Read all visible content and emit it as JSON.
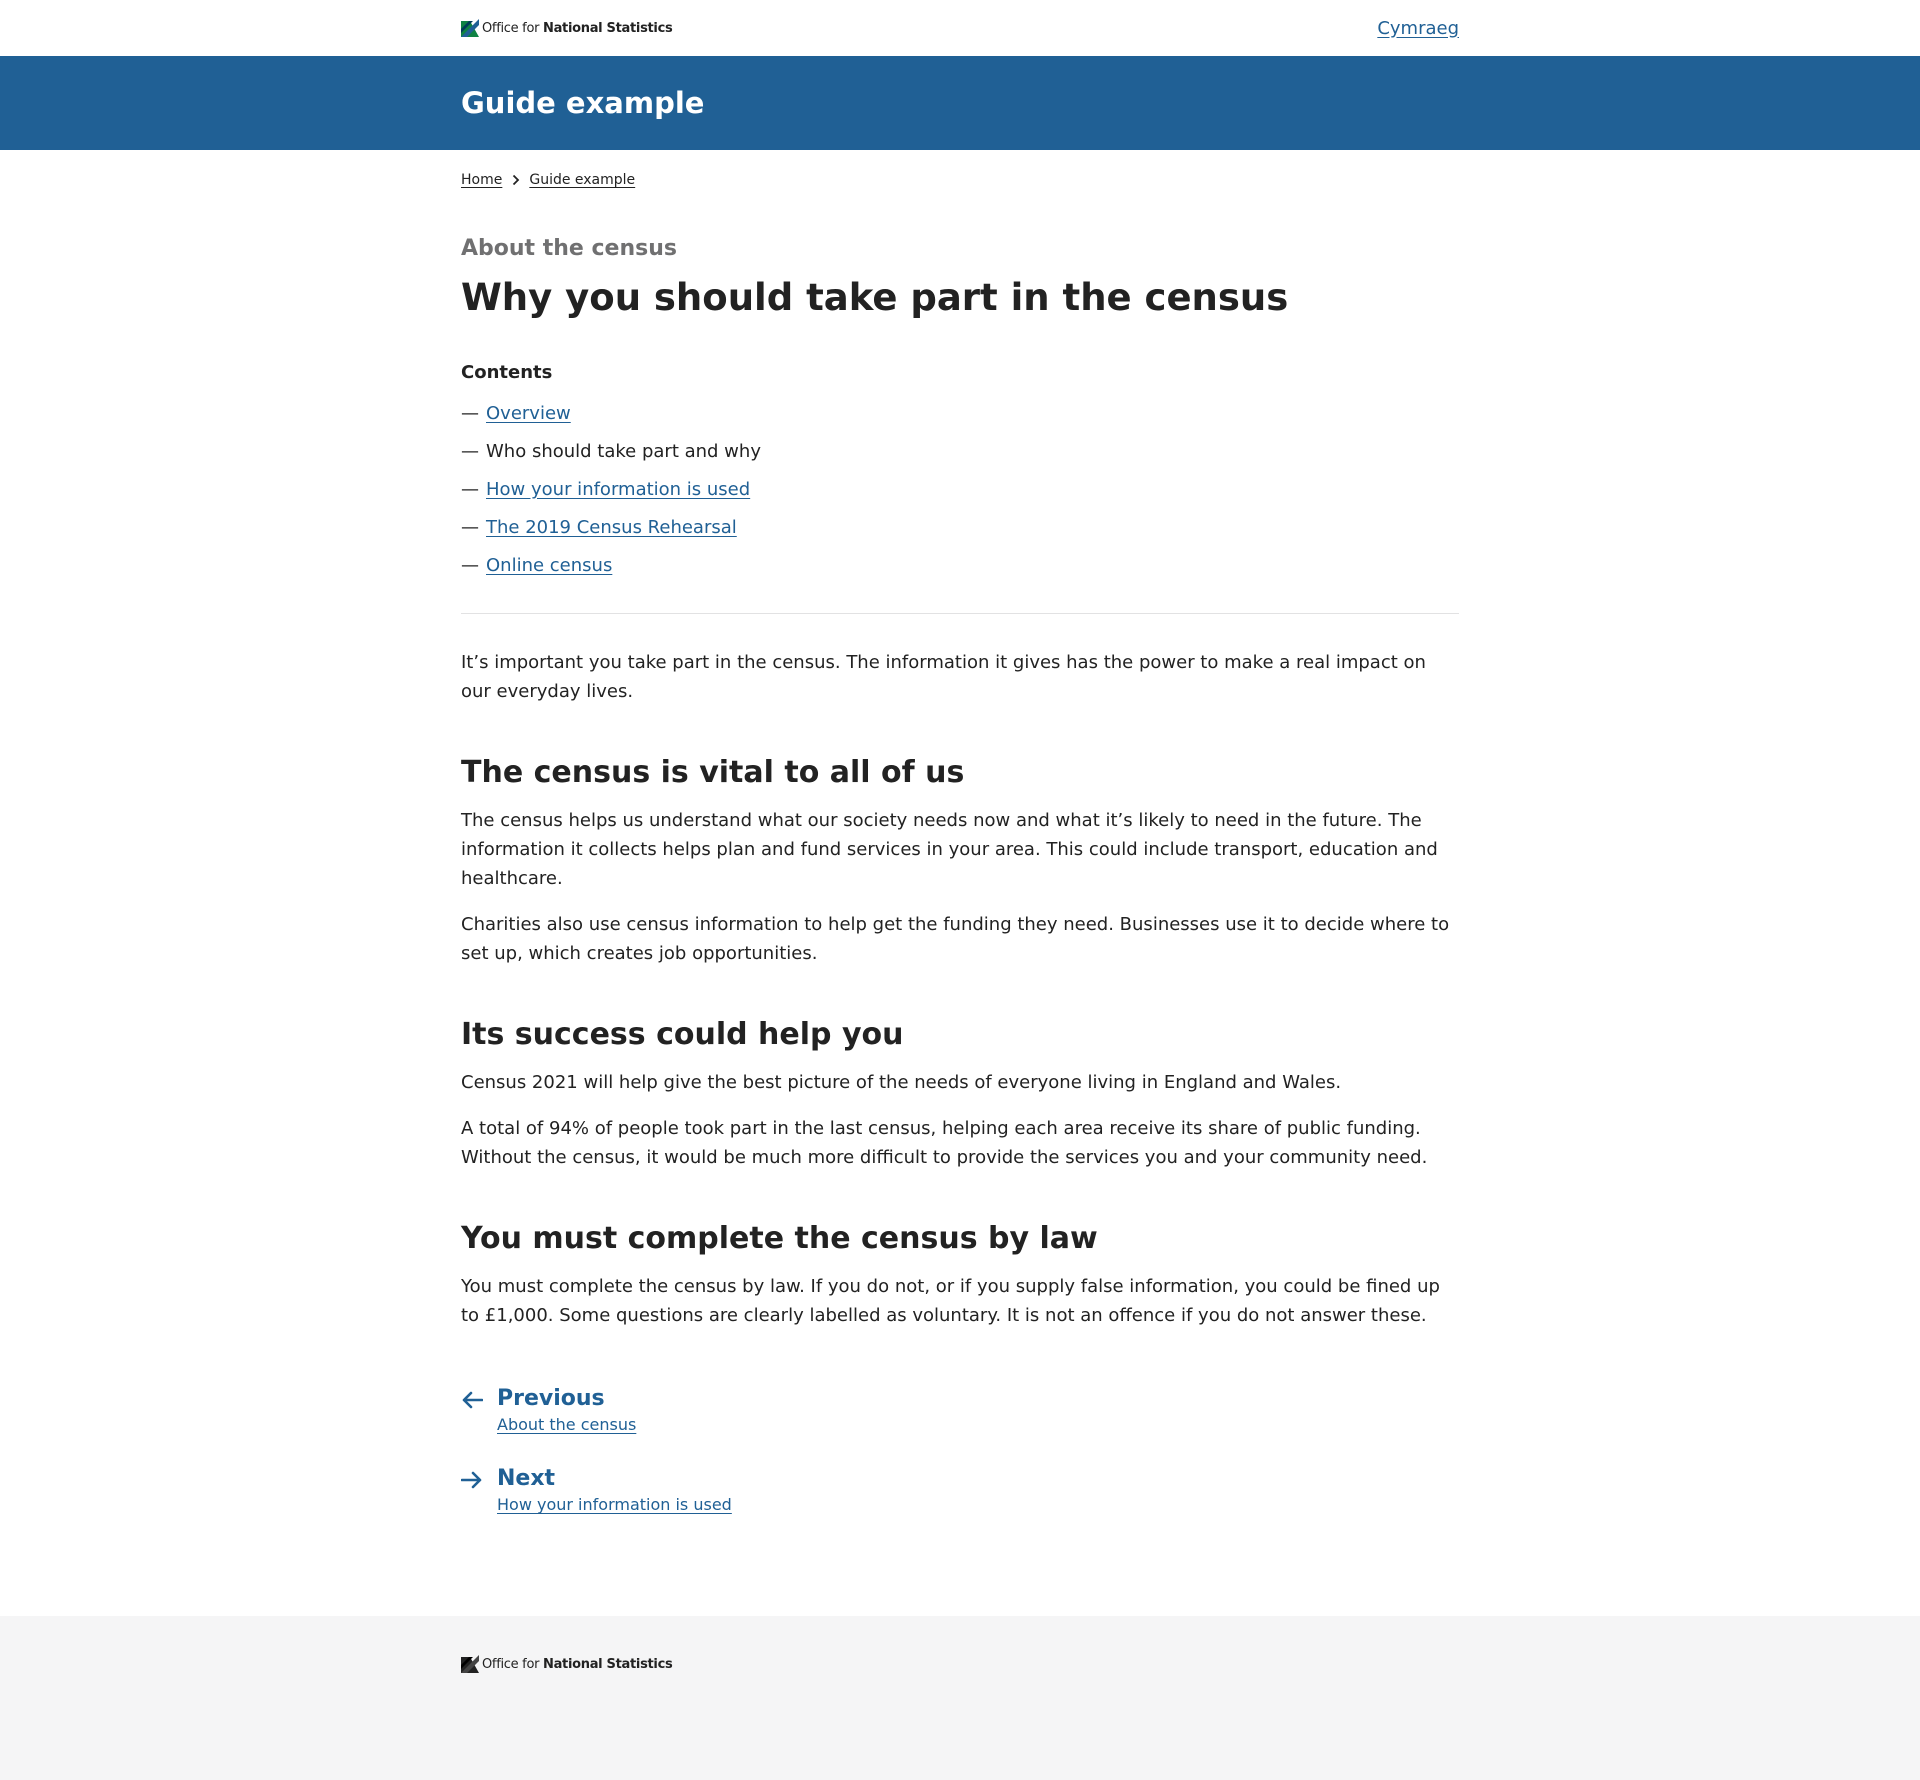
{
  "header": {
    "logo": {
      "text_regular": "Office for ",
      "text_bold": "National Statistics",
      "icon": "ons-logo-icon"
    },
    "language_link": "Cymraeg"
  },
  "title_band": {
    "title": "Guide example"
  },
  "breadcrumb": {
    "items": [
      "Home",
      "Guide example"
    ]
  },
  "guide": {
    "kicker": "About the census",
    "title": "Why you should take part in the census"
  },
  "contents": {
    "title": "Contents",
    "items": [
      {
        "label": "Overview",
        "current": false
      },
      {
        "label": "Who should take part and why",
        "current": true
      },
      {
        "label": "How your information is used",
        "current": false
      },
      {
        "label": "The 2019 Census Rehearsal",
        "current": false
      },
      {
        "label": "Online census",
        "current": false
      }
    ]
  },
  "article": {
    "intro": "It’s important you take part in the census. The information it gives has the power to make a real impact on our everyday lives.",
    "sections": [
      {
        "heading": "The census is vital to all of us",
        "paragraphs": [
          "The census helps us understand what our society needs now and what it’s likely to need in the future. The information it collects helps plan and fund services in your area. This could include transport, education and healthcare.",
          "Charities also use census information to help get the funding they need. Businesses use it to decide where to set up, which creates job opportunities."
        ]
      },
      {
        "heading": "Its success could help you",
        "paragraphs": [
          "Census 2021 will help give the best picture of the needs of everyone living in England and Wales.",
          "A total of 94% of people took part in the last census, helping each area receive its share of public funding. Without the census, it would be much more difficult to provide the services you and your community need."
        ]
      },
      {
        "heading": "You must complete the census by law",
        "paragraphs": [
          "You must complete the census by law. If you do not, or if you supply false information, you could be fined up to £1,000. Some questions are clearly labelled as voluntary. It is not an offence if you do not answer these."
        ]
      }
    ]
  },
  "pager": {
    "previous": {
      "label": "Previous",
      "link": "About the census",
      "icon": "arrow-left-icon"
    },
    "next": {
      "label": "Next",
      "link": "How your information is used",
      "icon": "arrow-right-icon"
    }
  },
  "footer": {
    "logo": {
      "text_regular": "Office for ",
      "text_bold": "National Statistics",
      "icon": "ons-logo-icon"
    }
  },
  "colors": {
    "brand_blue": "#206095",
    "text": "#222222",
    "muted": "#707071",
    "footer_bg": "#f5f5f6",
    "divider": "#e2e2e3"
  }
}
